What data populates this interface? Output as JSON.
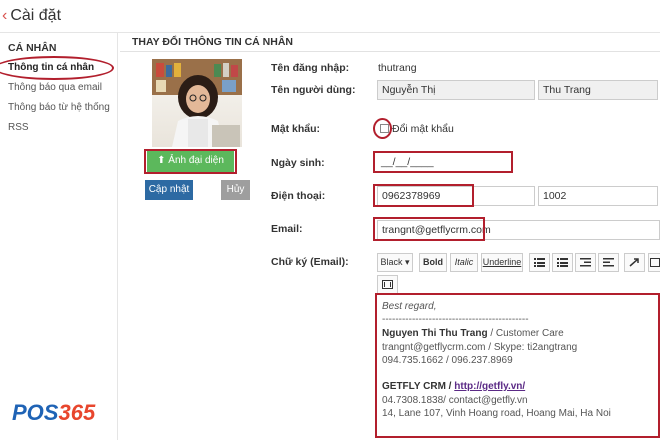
{
  "header": {
    "back_symbol": "‹",
    "title": "Cài đặt"
  },
  "sidebar": {
    "heading": "CÁ NHÂN",
    "items": [
      {
        "label": "Thông tin cá nhân"
      },
      {
        "label": "Thông báo qua email"
      },
      {
        "label": "Thông báo từ hệ thống"
      },
      {
        "label": "RSS"
      }
    ]
  },
  "main": {
    "section_title": "THAY ĐỔI THÔNG TIN CÁ NHÂN",
    "avatar_button": "Ảnh đại diện",
    "update_button": "Cập nhật",
    "cancel_button": "Hủy",
    "fields": {
      "username_label": "Tên đăng nhập:",
      "username_value": "thutrang",
      "fullname_label": "Tên người dùng:",
      "first_name": "Nguyễn Thị",
      "last_name": "Thu Trang",
      "password_label": "Mật khẩu:",
      "password_checkbox_label": "Đổi mật khẩu",
      "birthday_label": "Ngày sinh:",
      "birthday_value": "__/__/____",
      "phone_label": "Điện thoại:",
      "phone_value": "0962378969",
      "phone_ext": "1002",
      "email_label": "Email:",
      "email_value": "trangnt@getflycrm.com",
      "signature_label": "Chữ ký (Email):"
    },
    "toolbar": {
      "color": "Black",
      "bold": "Bold",
      "italic": "Italic",
      "underline": "Underline"
    },
    "signature": {
      "greeting": "Best regard,",
      "divider": "--------------------------------------------",
      "name": "Nguyen Thi Thu Trang",
      "role": " / Customer Care",
      "contact1": "trangnt@getflycrm.com / Skype: ti2angtrang",
      "phones": "094.735.1662 / 096.237.8969",
      "company": "GETFLY CRM",
      "company_sep": " / ",
      "website": "http://getfly.vn/",
      "contact2": "04.7308.1838/ contact@getfly.vn",
      "address": "14, Lane 107, Vinh Hoang road, Hoang Mai, Ha Noi"
    }
  },
  "watermark": {
    "text_a": "POS",
    "text_b": "365"
  },
  "colors": {
    "accent_red": "#b21f2d",
    "primary_blue": "#2d6aa3",
    "success_green": "#5cb85c",
    "link_purple": "#5b2a86"
  }
}
